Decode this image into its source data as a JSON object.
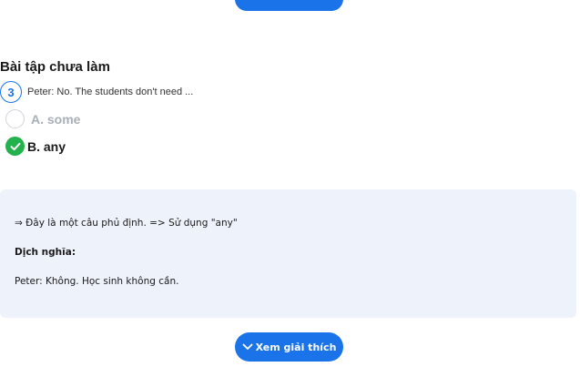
{
  "colors": {
    "accent": "#1a73e8",
    "correct": "#22b14c",
    "muted_option": "#a9afb8",
    "explain_background": "#eef2fb"
  },
  "section": {
    "title": "Bài tập chưa làm"
  },
  "question": {
    "number": "3",
    "text": "Peter: No. The students don't need ..."
  },
  "options": [
    {
      "label": "A. some",
      "state": "unselected"
    },
    {
      "label": "B. any",
      "state": "correct",
      "icon": "check-icon"
    }
  ],
  "explanation": {
    "line1": "⇒ Đây là một câu phủ định. => Sử dụng \"any\"",
    "heading": "Dịch nghĩa:",
    "translation": "Peter: Không. Học sinh không cần."
  },
  "buttons": {
    "show_explanation": "Xem giải thích",
    "show_explanation_icon": "chevron-down-icon"
  }
}
